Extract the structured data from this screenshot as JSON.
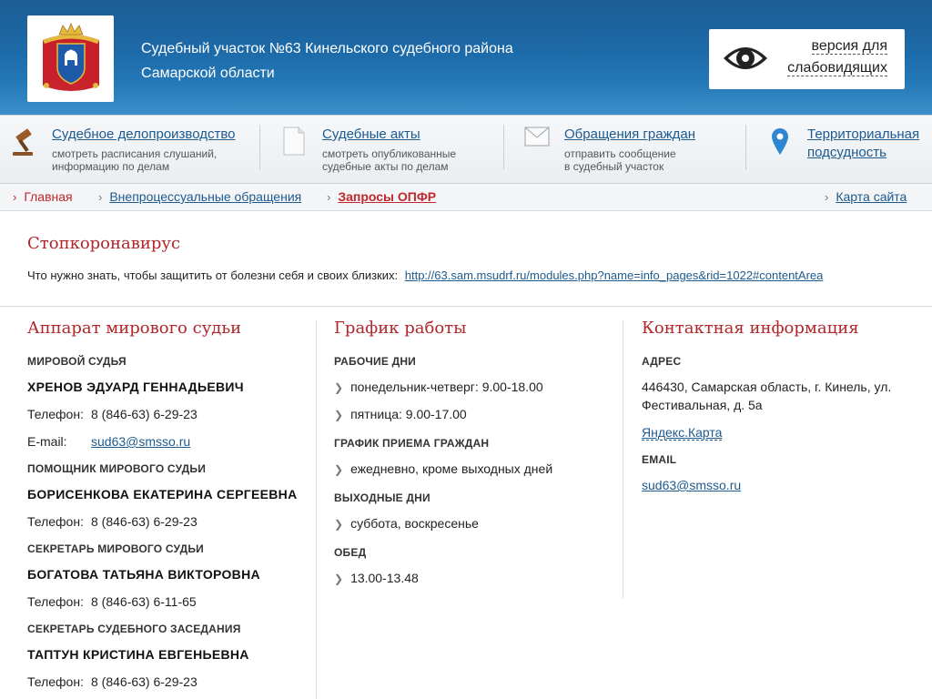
{
  "header": {
    "court_line1": "Судебный участок №63 Кинельского судебного района",
    "court_line2": "Самарской области",
    "vision_line1": "версия для",
    "vision_line2": "слабовидящих"
  },
  "nav": [
    {
      "title": "Судебное делопроизводство",
      "desc1": "смотреть расписания слушаний,",
      "desc2": "информацию по делам",
      "icon": "gavel-icon"
    },
    {
      "title": "Судебные акты",
      "desc1": "смотреть опубликованные",
      "desc2": "судебные акты по делам",
      "icon": "document-icon"
    },
    {
      "title": "Обращения граждан",
      "desc1": "отправить сообщение",
      "desc2": "в судебный участок",
      "icon": "envelope-icon"
    },
    {
      "title1": "Территориальная",
      "title2": "подсудность",
      "icon": "map-pin-icon"
    }
  ],
  "breadcrumb": {
    "home": "Главная",
    "level2": "Внепроцессуальные обращения",
    "current": "Запросы ОПФР",
    "sitemap": "Карта сайта"
  },
  "notice": {
    "title": "Стопкоронавирус",
    "text": "Что нужно знать, чтобы защитить от болезни себя и своих близких:",
    "link": "http://63.sam.msudrf.ru/modules.php?name=info_pages&rid=1022#contentArea"
  },
  "staff": {
    "title": "Аппарат мирового судьи",
    "phone_label": "Телефон:",
    "email_label": "E-mail:",
    "judge_label": "МИРОВОЙ СУДЬЯ",
    "judge_name": "ХРЕНОВ ЭДУАРД ГЕННАДЬЕВИЧ",
    "judge_phone": "8 (846-63) 6-29-23",
    "judge_email": "sud63@smsso.ru",
    "assistant_label": "ПОМОЩНИК МИРОВОГО СУДЬИ",
    "assistant_name": "БОРИСЕНКОВА ЕКАТЕРИНА СЕРГЕЕВНА",
    "assistant_phone": "8 (846-63) 6-29-23",
    "secretary_label": "СЕКРЕТАРЬ МИРОВОГО СУДЬИ",
    "secretary_name": "БОГАТОВА ТАТЬЯНА ВИКТОРОВНА",
    "secretary_phone": "8 (846-63) 6-11-65",
    "clerk_label": "СЕКРЕТАРЬ СУДЕБНОГО ЗАСЕДАНИЯ",
    "clerk_name": "ТАПТУН КРИСТИНА ЕВГЕНЬЕВНА",
    "clerk_phone": "8 (846-63) 6-29-23"
  },
  "schedule": {
    "title": "График работы",
    "workdays_label": "РАБОЧИЕ ДНИ",
    "workdays": [
      "понедельник-четверг: 9.00-18.00",
      "пятница: 9.00-17.00"
    ],
    "reception_label": "ГРАФИК ПРИЕМА ГРАЖДАН",
    "reception": "ежедневно, кроме выходных дней",
    "weekend_label": "ВЫХОДНЫЕ ДНИ",
    "weekend": "суббота, воскресенье",
    "lunch_label": "ОБЕД",
    "lunch": "13.00-13.48"
  },
  "contacts": {
    "title": "Контактная информация",
    "address_label": "АДРЕС",
    "address_line1": "446430, Самарская область, г. Кинель, ул.",
    "address_line2": "Фестивальная, д. 5а",
    "map_link": "Яндекс.Карта",
    "email_label": "EMAIL",
    "email": "sud63@smsso.ru"
  },
  "colors": {
    "header_blue": "#1d6aa8",
    "accent_red": "#b0262b",
    "link_blue": "#1d5a8e"
  }
}
